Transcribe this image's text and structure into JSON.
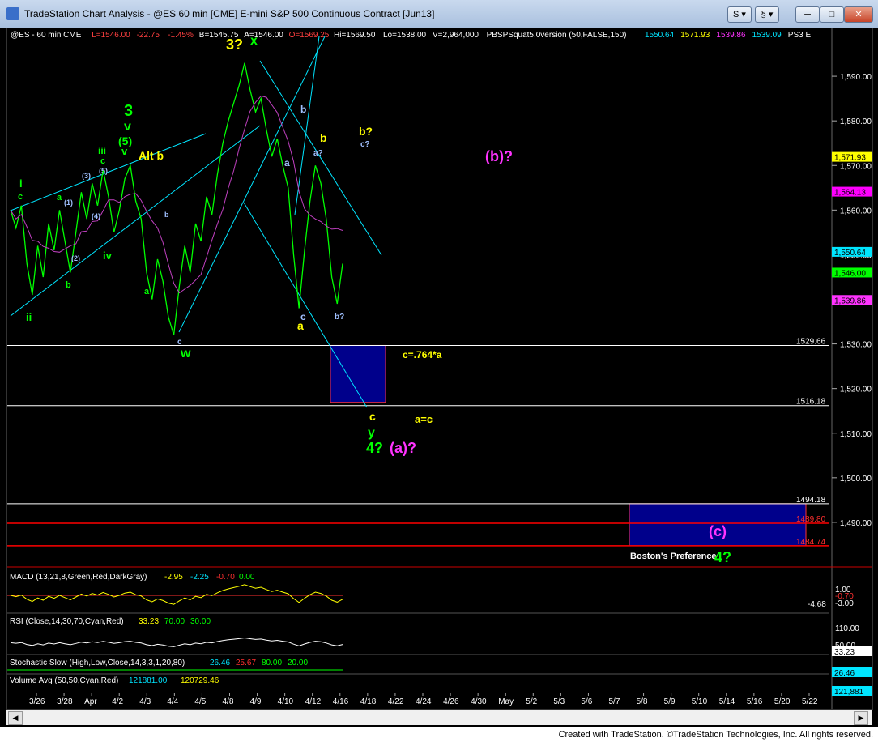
{
  "window": {
    "title": "TradeStation Chart Analysis - @ES 60 min [CME] E-mini S&P 500 Continuous Contract [Jun13]",
    "btn_s": "S",
    "btn_link": "§"
  },
  "header_items": [
    {
      "text": "@ES - 60 min  CME",
      "color": "#ffffff"
    },
    {
      "text": "L=1546.00",
      "color": "#ff4040"
    },
    {
      "text": "-22.75",
      "color": "#ff4040"
    },
    {
      "text": "-1.45%",
      "color": "#ff4040"
    },
    {
      "text": "B=1545.75",
      "color": "#ffffff"
    },
    {
      "text": "A=1546.00",
      "color": "#ffffff"
    },
    {
      "text": "O=1569.25",
      "color": "#ff4040"
    },
    {
      "text": "Hi=1569.50",
      "color": "#ffffff"
    },
    {
      "text": "Lo=1538.00",
      "color": "#ffffff"
    },
    {
      "text": "V=2,964,000",
      "color": "#ffffff"
    },
    {
      "text": "PBSPSquat5.0version (50,FALSE,150)",
      "color": "#ffffff"
    },
    {
      "text": "1550.64",
      "color": "#00e5ff"
    },
    {
      "text": "1571.93",
      "color": "#ffff00"
    },
    {
      "text": "1539.86",
      "color": "#ff33ff"
    },
    {
      "text": "1539.09",
      "color": "#00e5ff"
    },
    {
      "text": "PS3 E",
      "color": "#ffffff"
    }
  ],
  "panels": {
    "macd": {
      "label": "MACD (13,21,8,Green,Red,DarkGray)",
      "v1": "-2.95",
      "v2": "-2.25",
      "v3": "-0.70",
      "v4": "0.00",
      "axis": [
        "1.00",
        "-0.70",
        "-3.00",
        "-4.68"
      ]
    },
    "rsi": {
      "label": "RSI (Close,14,30,70,Cyan,Red)",
      "v1": "33.23",
      "v2": "70.00",
      "v3": "30.00",
      "axis": [
        "110.00",
        "50.00",
        "33.23"
      ]
    },
    "stoch": {
      "label": "Stochastic Slow (High,Low,Close,14,3,3,1,20,80)",
      "v1": "26.46",
      "v2": "25.67",
      "v3": "80.00",
      "v4": "20.00",
      "axis": [
        "26.46"
      ]
    },
    "volume": {
      "label": "Volume Avg (50,50,Cyan,Red)",
      "v1": "121881.00",
      "v2": "120729.46",
      "axis": [
        "121,881"
      ]
    }
  },
  "chart_data": {
    "type": "line",
    "title": "",
    "ylim": [
      1480,
      1600
    ],
    "y_ticks": [
      1490,
      1500,
      1510,
      1520,
      1530,
      1540,
      1550,
      1560,
      1570,
      1580,
      1590
    ],
    "y_tick_labels": [
      "1,490.00",
      "1,500.00",
      "1,510.00",
      "1,520.00",
      "1,530.00",
      "1,540.00",
      "1,550.00",
      "1,560.00",
      "1,570.00",
      "1,580.00",
      "1,590.00"
    ],
    "x_tick_labels": [
      "3/26",
      "3/28",
      "Apr",
      "4/2",
      "4/3",
      "4/4",
      "4/5",
      "4/8",
      "4/9",
      "4/10",
      "4/12",
      "4/16",
      "4/18",
      "4/22",
      "4/24",
      "4/26",
      "4/30",
      "May",
      "5/2",
      "5/3",
      "5/6",
      "5/7",
      "5/8",
      "5/9",
      "5/10",
      "5/14",
      "5/16",
      "5/20",
      "5/22"
    ],
    "price_tags": [
      {
        "value": 1571.93,
        "label": "1,571.93",
        "bg": "#ffff00",
        "fg": "#000000"
      },
      {
        "value": 1564.13,
        "label": "1,564.13",
        "bg": "#ff00ff",
        "fg": "#000000"
      },
      {
        "value": 1550.64,
        "label": "1,550.64",
        "bg": "#00e5ff",
        "fg": "#000000"
      },
      {
        "value": 1546.0,
        "label": "1,546.00",
        "bg": "#00ff00",
        "fg": "#000000"
      },
      {
        "value": 1539.86,
        "label": "1,539.86",
        "bg": "#ff33ff",
        "fg": "#000000"
      }
    ],
    "horizontal_levels": [
      {
        "value": 1529.66,
        "label": "1529.66",
        "color": "#ffffff"
      },
      {
        "value": 1516.18,
        "label": "1516.18",
        "color": "#ffffff"
      },
      {
        "value": 1494.18,
        "label": "1494.18",
        "color": "#ffffff"
      },
      {
        "value": 1489.8,
        "label": "1489.80",
        "color": "#ff0000"
      },
      {
        "value": 1484.74,
        "label": "1484.74",
        "color": "#ff0000"
      }
    ],
    "price_series": [
      1560,
      1556,
      1561,
      1548,
      1541,
      1552,
      1545,
      1557,
      1551,
      1560,
      1553,
      1546,
      1555,
      1564,
      1558,
      1566,
      1561,
      1569,
      1563,
      1555,
      1560,
      1567,
      1570,
      1562,
      1558,
      1546,
      1540,
      1549,
      1544,
      1536,
      1532,
      1543,
      1552,
      1546,
      1557,
      1553,
      1563,
      1559,
      1568,
      1575,
      1580,
      1584,
      1588,
      1593,
      1587,
      1582,
      1585,
      1578,
      1572,
      1576,
      1570,
      1565,
      1550,
      1538,
      1551,
      1562,
      1570,
      1566,
      1558,
      1545,
      1539,
      1548
    ],
    "annotations": [
      {
        "text": "3?",
        "color": "#ffff00",
        "size": 18
      },
      {
        "text": "x",
        "color": "#00ff00",
        "size": 16
      },
      {
        "text": "b",
        "color": "#a0c0ff",
        "size": 12
      },
      {
        "text": "b",
        "color": "#ffff00",
        "size": 14
      },
      {
        "text": "b?",
        "color": "#ffff00",
        "size": 14
      },
      {
        "text": "c?",
        "color": "#a0c0ff",
        "size": 10
      },
      {
        "text": "a?",
        "color": "#a0c0ff",
        "size": 10
      },
      {
        "text": "a",
        "color": "#a0c0ff",
        "size": 12
      },
      {
        "text": "3",
        "color": "#00ff00",
        "size": 20
      },
      {
        "text": "v",
        "color": "#00ff00",
        "size": 16
      },
      {
        "text": "(5)",
        "color": "#00ff00",
        "size": 14
      },
      {
        "text": "v",
        "color": "#00ff00",
        "size": 13
      },
      {
        "text": "Alt b",
        "color": "#ffff00",
        "size": 14
      },
      {
        "text": "iii",
        "color": "#00ff00",
        "size": 12
      },
      {
        "text": "c",
        "color": "#00ff00",
        "size": 11
      },
      {
        "text": "(5)",
        "color": "#a0c0ff",
        "size": 9
      },
      {
        "text": "(3)",
        "color": "#a0c0ff",
        "size": 9
      },
      {
        "text": "i",
        "color": "#00ff00",
        "size": 13
      },
      {
        "text": "c",
        "color": "#00ff00",
        "size": 11
      },
      {
        "text": "a",
        "color": "#00ff00",
        "size": 11
      },
      {
        "text": "(1)",
        "color": "#a0c0ff",
        "size": 9
      },
      {
        "text": "(4)",
        "color": "#a0c0ff",
        "size": 9
      },
      {
        "text": "(2)",
        "color": "#a0c0ff",
        "size": 9
      },
      {
        "text": "b",
        "color": "#00ff00",
        "size": 11
      },
      {
        "text": "iv",
        "color": "#00ff00",
        "size": 13
      },
      {
        "text": "ii",
        "color": "#00ff00",
        "size": 13
      },
      {
        "text": "a",
        "color": "#00ff00",
        "size": 11
      },
      {
        "text": "b",
        "color": "#a0c0ff",
        "size": 9
      },
      {
        "text": "c",
        "color": "#a0c0ff",
        "size": 10
      },
      {
        "text": "w",
        "color": "#00ff00",
        "size": 16
      },
      {
        "text": "c",
        "color": "#a0c0ff",
        "size": 12
      },
      {
        "text": "a",
        "color": "#ffff00",
        "size": 14
      },
      {
        "text": "b?",
        "color": "#a0c0ff",
        "size": 10
      },
      {
        "text": "(b)?",
        "color": "#ff33ff",
        "size": 18
      },
      {
        "text": "c=.764*a",
        "color": "#ffff00",
        "size": 12
      },
      {
        "text": "c",
        "color": "#ffff00",
        "size": 14
      },
      {
        "text": "y",
        "color": "#00ff00",
        "size": 16
      },
      {
        "text": "4?",
        "color": "#00ff00",
        "size": 18
      },
      {
        "text": "(a)?",
        "color": "#ff33ff",
        "size": 18
      },
      {
        "text": "a=c",
        "color": "#ffff00",
        "size": 13
      },
      {
        "text": "(c)",
        "color": "#ff33ff",
        "size": 18
      },
      {
        "text": "Boston's Preference",
        "color": "#ffffff",
        "size": 11
      },
      {
        "text": "4?",
        "color": "#00ff00",
        "size": 18
      }
    ]
  },
  "footer": {
    "text": "Created with TradeStation. ©TradeStation Technologies, Inc. All rights reserved."
  },
  "colors": {
    "price": "#00ff00",
    "trendline": "#00e5ff",
    "ma": "#c040c0",
    "box_fill": "#00008b"
  }
}
